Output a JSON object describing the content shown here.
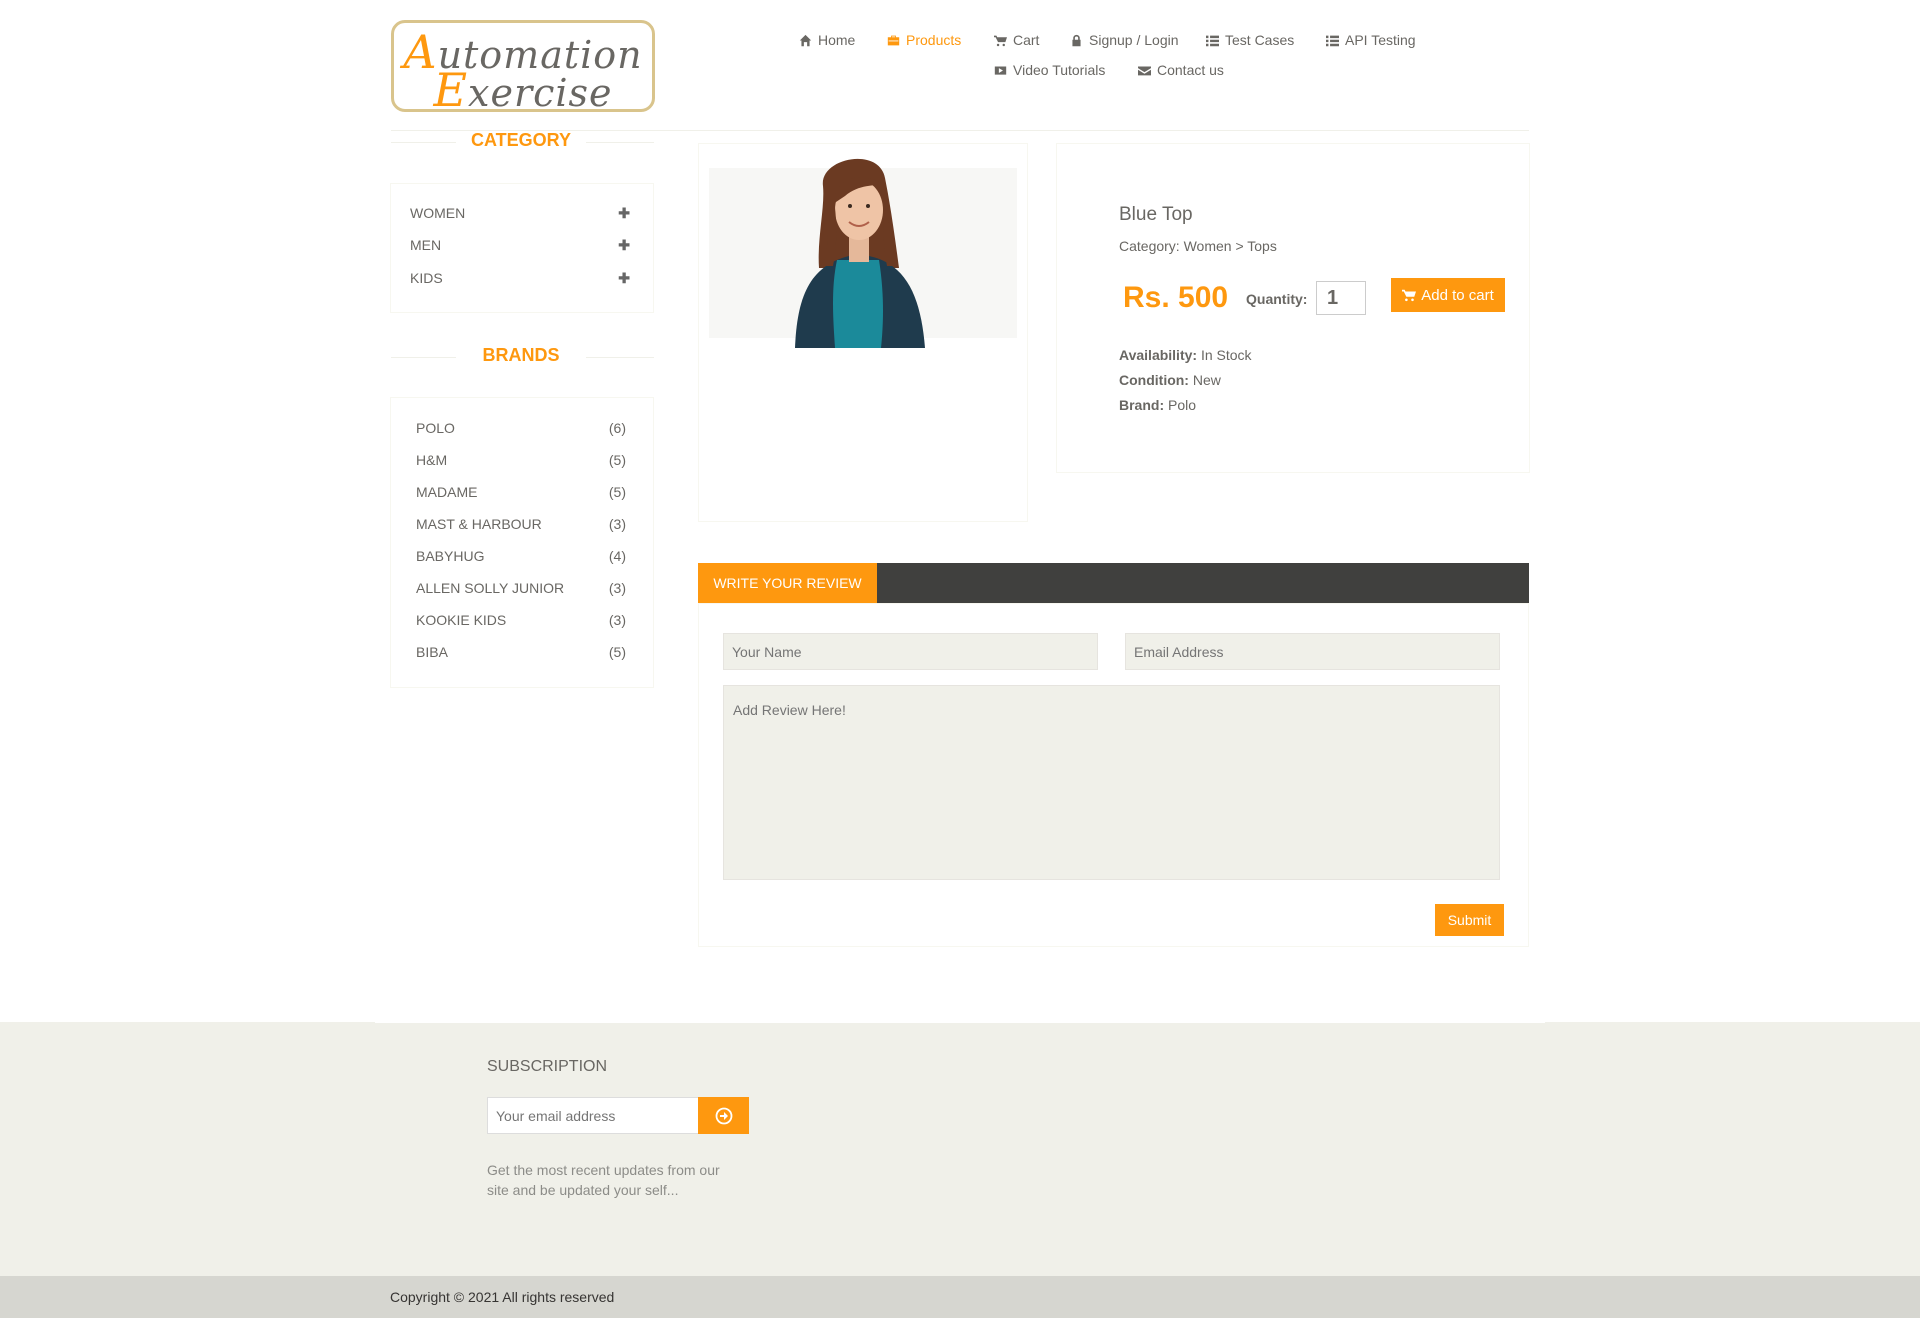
{
  "header": {
    "logo_line1": "Automation",
    "logo_line2": "Exercise",
    "nav": [
      {
        "label": "Home",
        "icon": "home-icon"
      },
      {
        "label": "Products",
        "icon": "products-icon",
        "active": true
      },
      {
        "label": "Cart",
        "icon": "cart-icon"
      },
      {
        "label": "Signup / Login",
        "icon": "lock-icon"
      },
      {
        "label": "Test Cases",
        "icon": "list-icon"
      },
      {
        "label": "API Testing",
        "icon": "list-icon"
      },
      {
        "label": "Video Tutorials",
        "icon": "youtube-play-icon"
      },
      {
        "label": "Contact us",
        "icon": "envelope-icon"
      }
    ]
  },
  "sidebar": {
    "category_title": "Category",
    "categories": [
      {
        "label": "WOMEN"
      },
      {
        "label": "MEN"
      },
      {
        "label": "KIDS"
      }
    ],
    "brands_title": "Brands",
    "brands": [
      {
        "label": "POLO",
        "count": "(6)"
      },
      {
        "label": "H&M",
        "count": "(5)"
      },
      {
        "label": "MADAME",
        "count": "(5)"
      },
      {
        "label": "MAST & HARBOUR",
        "count": "(3)"
      },
      {
        "label": "BABYHUG",
        "count": "(4)"
      },
      {
        "label": "ALLEN SOLLY JUNIOR",
        "count": "(3)"
      },
      {
        "label": "KOOKIE KIDS",
        "count": "(3)"
      },
      {
        "label": "BIBA",
        "count": "(5)"
      }
    ]
  },
  "product": {
    "name": "Blue Top",
    "category": "Category: Women > Tops",
    "price": "Rs. 500",
    "quantity_label": "Quantity:",
    "quantity_value": "1",
    "add_to_cart": "Add to cart",
    "availability_label": "Availability:",
    "availability_value": "In Stock",
    "condition_label": "Condition:",
    "condition_value": "New",
    "brand_label": "Brand:",
    "brand_value": "Polo"
  },
  "review": {
    "tab_label": "WRITE YOUR REVIEW",
    "name_placeholder": "Your Name",
    "email_placeholder": "Email Address",
    "review_placeholder": "Add Review Here!",
    "submit_label": "Submit"
  },
  "footer": {
    "subscription_title": "SUBSCRIPTION",
    "email_placeholder": "Your email address",
    "subscription_text": "Get the most recent updates from our site and be updated your self...",
    "copyright": "Copyright © 2021 All rights reserved"
  },
  "colors": {
    "accent": "#fe980f",
    "text": "#696763",
    "dark_bar": "#40403e",
    "footer_bg": "#f0f0e9"
  }
}
